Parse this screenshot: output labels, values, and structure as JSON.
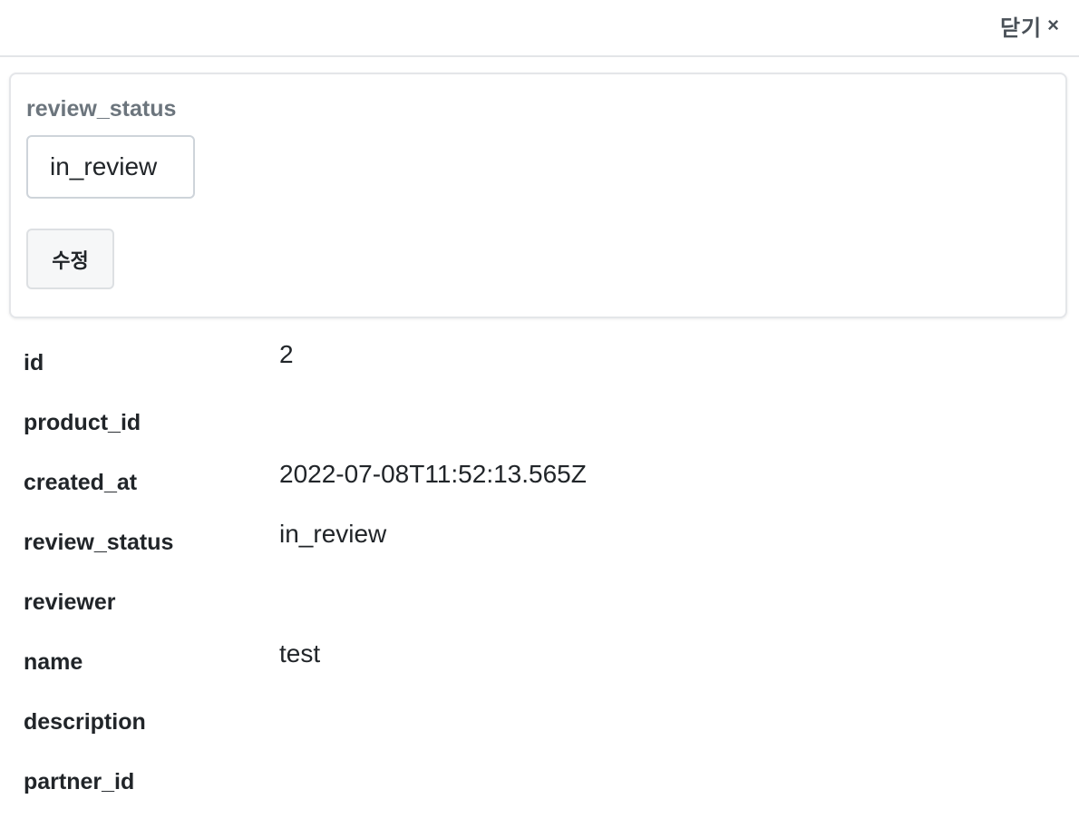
{
  "header": {
    "close_label": "닫기",
    "close_icon": "×"
  },
  "edit_form": {
    "field_label": "review_status",
    "input_value": "in_review",
    "submit_label": "수정"
  },
  "details": [
    {
      "key": "id",
      "value": "2"
    },
    {
      "key": "product_id",
      "value": ""
    },
    {
      "key": "created_at",
      "value": "2022-07-08T11:52:13.565Z"
    },
    {
      "key": "review_status",
      "value": "in_review"
    },
    {
      "key": "reviewer",
      "value": ""
    },
    {
      "key": "name",
      "value": "test"
    },
    {
      "key": "description",
      "value": ""
    },
    {
      "key": "partner_id",
      "value": ""
    }
  ]
}
